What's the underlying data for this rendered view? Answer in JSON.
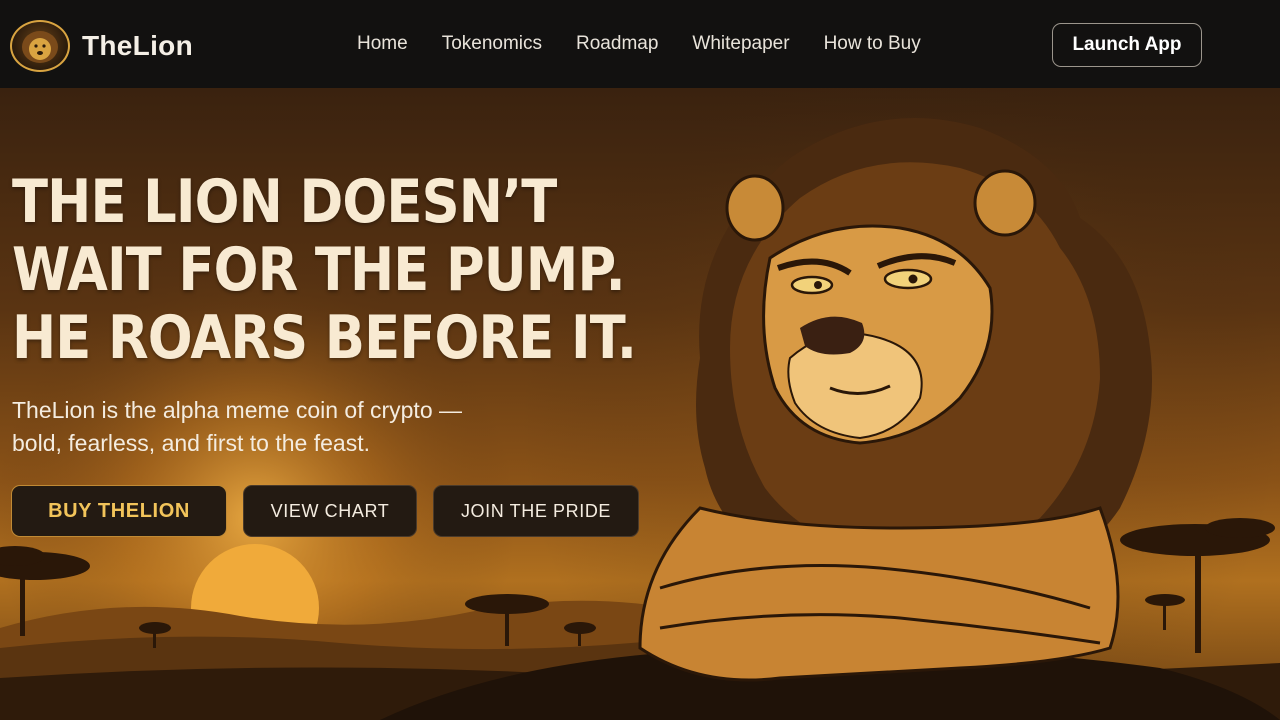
{
  "brand": {
    "name": "TheLion",
    "logo_icon": "lion-logo-icon"
  },
  "nav": {
    "links": [
      "Home",
      "Tokenomics",
      "Roadmap",
      "Whitepaper",
      "How to Buy"
    ],
    "launch_label": "Launch App"
  },
  "hero": {
    "headline_lines": [
      "THE LION DOESN’T",
      "WAIT FOR THE PUMP.",
      "HE ROARS BEFORE IT."
    ],
    "subtitle_lines": [
      "TheLion is the alpha meme coin of crypto —",
      "bold, fearless, and first to the feast."
    ],
    "buttons": {
      "buy": "BUY THELION",
      "chart": "VIEW CHART",
      "pride": "JOIN THE PRIDE"
    },
    "illustration": "lion-mascot-illustration"
  },
  "colors": {
    "nav_bg": "#121110",
    "accent_gold": "#f2c45a",
    "headline": "#f8ead2",
    "button_bg": "#231a12"
  }
}
